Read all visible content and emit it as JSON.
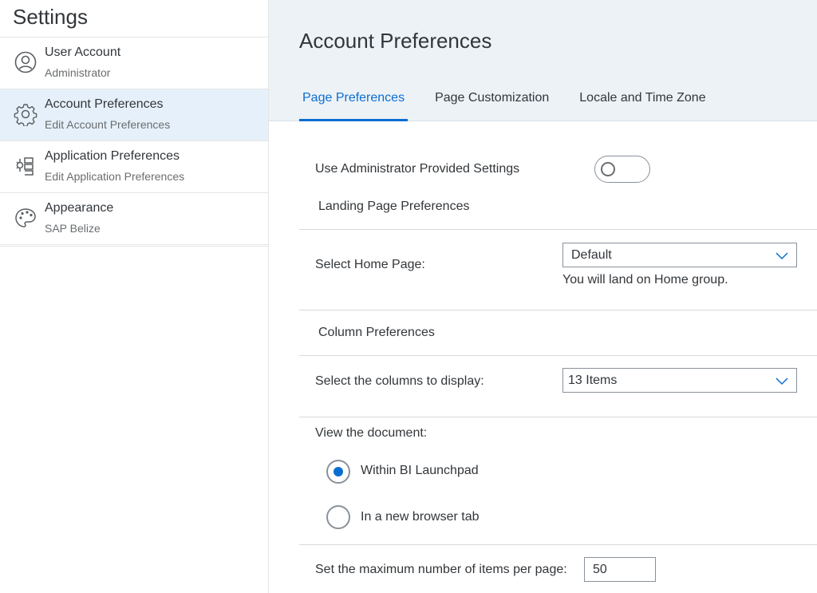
{
  "sidebar": {
    "title": "Settings",
    "items": [
      {
        "title": "User Account",
        "desc": "Administrator",
        "icon": "user-icon"
      },
      {
        "title": "Account Preferences",
        "desc": "Edit Account Preferences",
        "icon": "gear-icon"
      },
      {
        "title": "Application Preferences",
        "desc": "Edit Application Preferences",
        "icon": "application-icon"
      },
      {
        "title": "Appearance",
        "desc": "SAP Belize",
        "icon": "palette-icon"
      }
    ]
  },
  "main": {
    "title": "Account Preferences",
    "tabs": [
      {
        "label": "Page Preferences",
        "active": true
      },
      {
        "label": "Page Customization",
        "active": false
      },
      {
        "label": "Locale and Time Zone",
        "active": false
      }
    ],
    "admin_settings_label": "Use Administrator Provided Settings",
    "landing_section": "Landing Page Preferences",
    "home_page_label": "Select Home Page:",
    "home_page_value": "Default",
    "home_page_hint": "You will land on Home group.",
    "column_section": "Column Preferences",
    "columns_label": "Select the columns to display:",
    "columns_value": "13 Items",
    "view_doc_label": "View the document:",
    "view_options": [
      {
        "label": "Within BI Launchpad",
        "checked": true
      },
      {
        "label": "In a new browser tab",
        "checked": false
      }
    ],
    "max_items_label": "Set the maximum number of items per page:",
    "max_items_value": "50"
  },
  "colors": {
    "accent": "#0a6ed1",
    "selected_bg": "#e5f0fa",
    "header_bg": "#edf2f7"
  }
}
